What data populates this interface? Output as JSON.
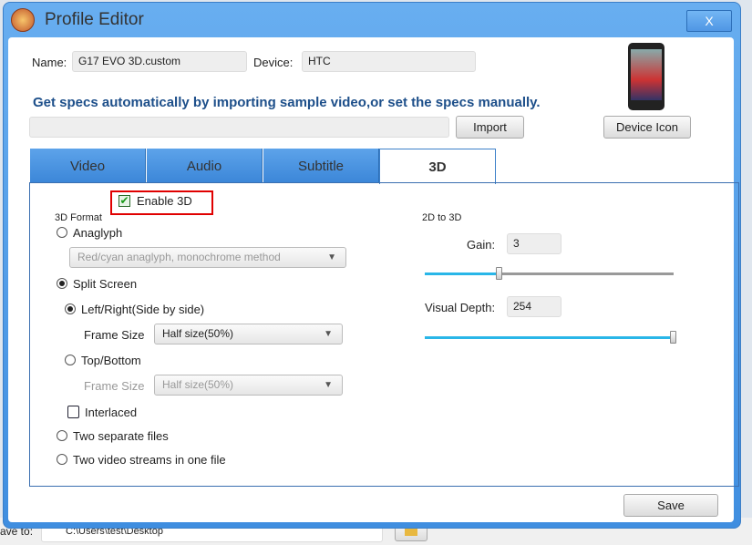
{
  "window": {
    "title": "Profile Editor",
    "close_label": "X"
  },
  "form": {
    "name_label": "Name:",
    "name_value": "G17 EVO 3D.custom",
    "device_label": "Device:",
    "device_value": "HTC",
    "headline": "Get specs automatically by importing sample video,or set the specs manually.",
    "import_path": "",
    "import_label": "Import",
    "device_icon_label": "Device Icon"
  },
  "tabs": [
    {
      "label": "Video"
    },
    {
      "label": "Audio"
    },
    {
      "label": "Subtitle"
    },
    {
      "label": "3D"
    }
  ],
  "three_d": {
    "enable_label": "Enable 3D",
    "enable_checked": true,
    "format_label": "3D Format",
    "anaglyph_label": "Anaglyph",
    "anaglyph_method": "Red/cyan anaglyph, monochrome method",
    "split_label": "Split Screen",
    "lr_label": "Left/Right(Side by side)",
    "frame_size_label": "Frame Size",
    "lr_frame_size": "Half size(50%)",
    "tb_label": "Top/Bottom",
    "tb_frame_size": "Half size(50%)",
    "interlaced_label": "Interlaced",
    "two_files_label": "Two separate files",
    "two_streams_label": "Two video streams in one file",
    "to3d_label": "2D to 3D",
    "gain_label": "Gain:",
    "gain_value": "3",
    "gain_slider_percent": 30,
    "depth_label": "Visual Depth:",
    "depth_value": "254",
    "depth_slider_percent": 100
  },
  "save_label": "Save",
  "background": {
    "save_to_label": "ave to:",
    "save_to_path": "C:\\Users\\test\\Desktop"
  }
}
